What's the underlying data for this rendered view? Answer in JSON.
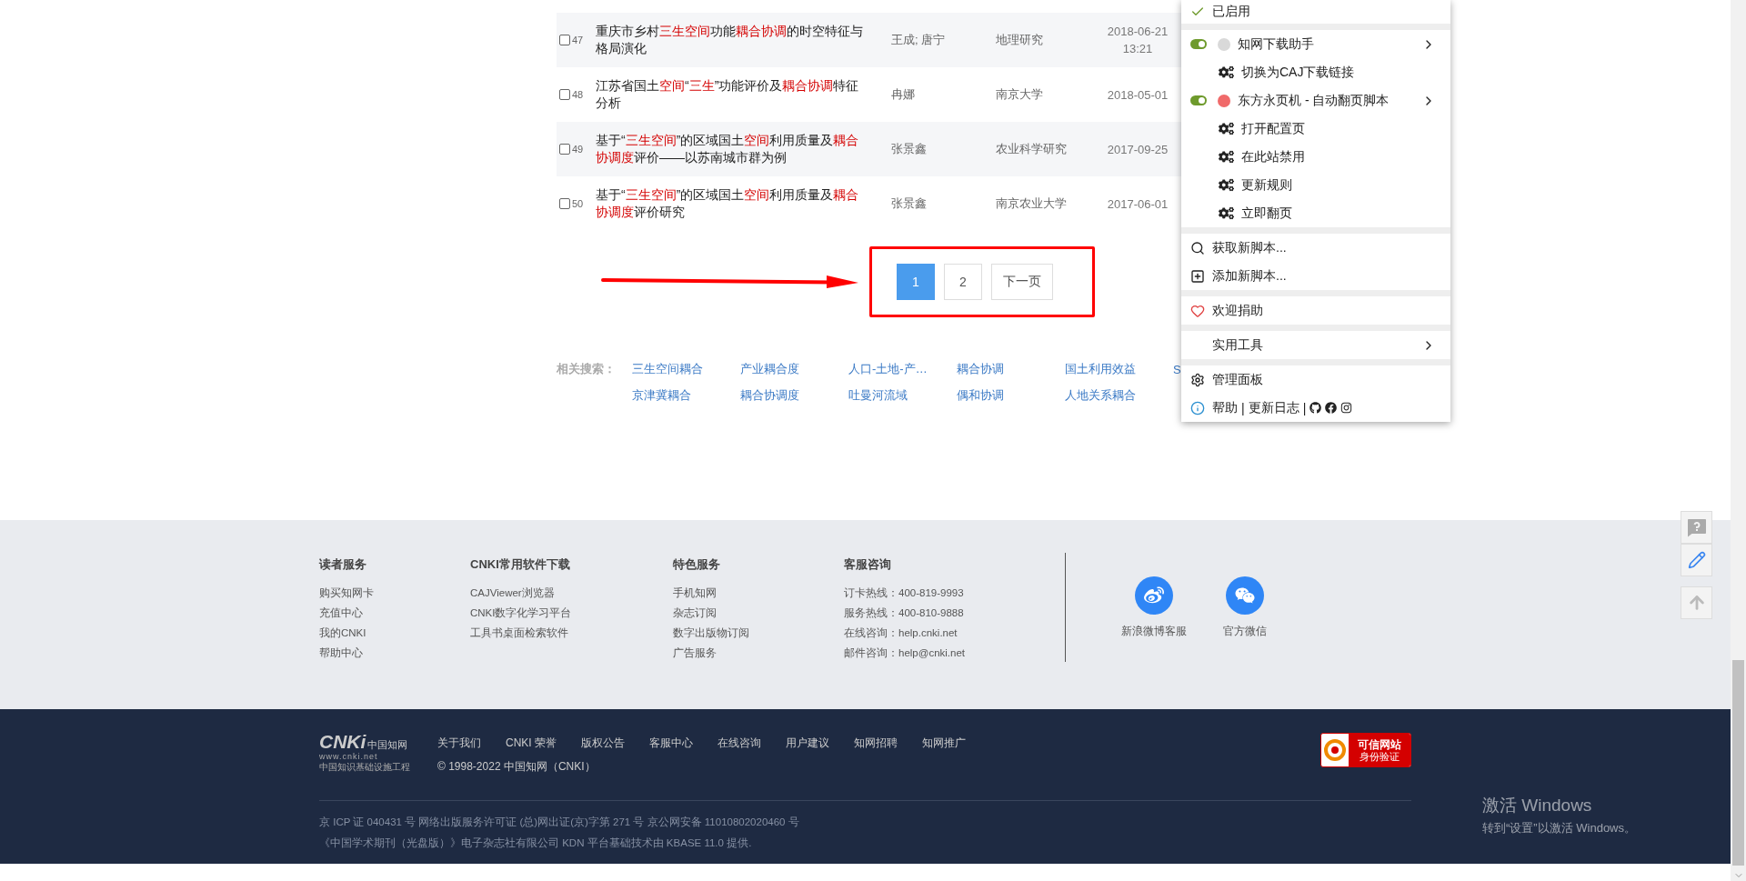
{
  "results": {
    "rows": [
      {
        "number": "47",
        "checked": false,
        "title": [
          {
            "text": "重庆市乡村",
            "highlight": false
          },
          {
            "text": "三生空间",
            "highlight": true
          },
          {
            "text": "功能",
            "highlight": false
          },
          {
            "text": "耦合协调",
            "highlight": true
          },
          {
            "text": "的时空特征与格局演化",
            "highlight": false
          }
        ],
        "author": "王成; 唐宁",
        "source": "地理研究",
        "date": "2018-06-21 13:21"
      },
      {
        "number": "48",
        "checked": false,
        "title": [
          {
            "text": "江苏省国土",
            "highlight": false
          },
          {
            "text": "空间",
            "highlight": true
          },
          {
            "text": "“",
            "highlight": false
          },
          {
            "text": "三生",
            "highlight": true
          },
          {
            "text": "”功能评价及",
            "highlight": false
          },
          {
            "text": "耦合协调",
            "highlight": true
          },
          {
            "text": "特征分析",
            "highlight": false
          }
        ],
        "author": "冉娜",
        "source": "南京大学",
        "date": "2018-05-01"
      },
      {
        "number": "49",
        "checked": false,
        "title": [
          {
            "text": "基于“",
            "highlight": false
          },
          {
            "text": "三生空间",
            "highlight": true
          },
          {
            "text": "”的区域国土",
            "highlight": false
          },
          {
            "text": "空间",
            "highlight": true
          },
          {
            "text": "利用质量及",
            "highlight": false
          },
          {
            "text": "耦合协调度",
            "highlight": true
          },
          {
            "text": "评价——以苏南城市群为例",
            "highlight": false
          }
        ],
        "author": "张景鑫",
        "source": "农业科学研究",
        "date": "2017-09-25"
      },
      {
        "number": "50",
        "checked": false,
        "title": [
          {
            "text": "基于“",
            "highlight": false
          },
          {
            "text": "三生空间",
            "highlight": true
          },
          {
            "text": "”的区域国土",
            "highlight": false
          },
          {
            "text": "空间",
            "highlight": true
          },
          {
            "text": "利用质量及",
            "highlight": false
          },
          {
            "text": "耦合协调度",
            "highlight": true
          },
          {
            "text": "评价研究",
            "highlight": false
          }
        ],
        "author": "张景鑫",
        "source": "南京农业大学",
        "date": "2017-06-01"
      }
    ]
  },
  "pagination": {
    "pages": [
      {
        "label": "1",
        "selected": true
      },
      {
        "label": "2",
        "selected": false
      }
    ],
    "next": "下一页"
  },
  "related_search": {
    "label": "相关搜索：",
    "items": [
      "三生空间耦合",
      "产业耦合度",
      "人口-土地-产…",
      "耦合协调",
      "国土利用效益",
      "S",
      "京津冀耦合",
      "耦合协调度",
      "吐曼河流域",
      "偶和协调",
      "人地关系耦合"
    ]
  },
  "script_menu": {
    "sections": [
      [
        {
          "kind": "status",
          "label": "已启用"
        }
      ],
      [
        {
          "kind": "script",
          "label": "知网下载助手",
          "on": true,
          "color": "#d9d9d9"
        },
        {
          "kind": "command",
          "label": "切换为CAJ下载链接"
        },
        {
          "kind": "script",
          "label": "东方永页机 - 自动翻页脚本",
          "on": true,
          "color": "#f06a6a"
        },
        {
          "kind": "command",
          "label": "打开配置页"
        },
        {
          "kind": "command",
          "label": "在此站禁用"
        },
        {
          "kind": "command",
          "label": "更新规则"
        },
        {
          "kind": "command",
          "label": "立即翻页"
        }
      ],
      [
        {
          "kind": "search",
          "label": "获取新脚本..."
        },
        {
          "kind": "add",
          "label": "添加新脚本..."
        }
      ],
      [
        {
          "kind": "donate",
          "label": "欢迎捐助"
        }
      ],
      [
        {
          "kind": "submenu",
          "label": "实用工具"
        }
      ],
      [
        {
          "kind": "dashboard",
          "label": "管理面板"
        },
        {
          "kind": "help",
          "links": [
            "帮助",
            "更新日志"
          ],
          "separator": "|"
        }
      ]
    ]
  },
  "footer": {
    "columns": [
      {
        "title": "读者服务",
        "links": [
          "购买知网卡",
          "充值中心",
          "我的CNKI",
          "帮助中心"
        ]
      },
      {
        "title": "CNKI常用软件下载",
        "links": [
          "CAJViewer浏览器",
          "CNKI数字化学习平台",
          "工具书桌面检索软件"
        ]
      },
      {
        "title": "特色服务",
        "links": [
          "手机知网",
          "杂志订阅",
          "数字出版物订阅",
          "广告服务"
        ]
      },
      {
        "title": "客服咨询",
        "links": [
          "订卡热线：400-819-9993",
          "服务热线：400-810-9888",
          "在线咨询：help.cnki.net",
          "邮件咨询：help@cnki.net"
        ]
      }
    ],
    "social": [
      {
        "kind": "weibo",
        "label": "新浪微博客服"
      },
      {
        "kind": "wechat",
        "label": "官方微信"
      }
    ]
  },
  "bottom_footer": {
    "logo": {
      "mark": "CNKi",
      "name": "中国知网",
      "url": "www.cnki.net",
      "slogan": "中国知识基础设施工程"
    },
    "links": [
      "关于我们",
      "CNKI 荣誉",
      "版权公告",
      "客服中心",
      "在线咨询",
      "用户建议",
      "知网招聘",
      "知网推广"
    ],
    "copyright": "© 1998-2022 中国知网（CNKI）",
    "badge": {
      "title": "可信网站",
      "subtitle": "身份验证"
    },
    "legal": [
      "京 ICP 证 040431 号 网络出版服务许可证 (总)网出证(京)字第 271 号 京公网安备 11010802020460 号",
      "《中国学术期刊（光盘版）》电子杂志社有限公司 KDN 平台基础技术由 KBASE 11.0 提供."
    ]
  },
  "os_notice": {
    "title": "激活 Windows",
    "text": "转到“设置”以激活 Windows。"
  }
}
